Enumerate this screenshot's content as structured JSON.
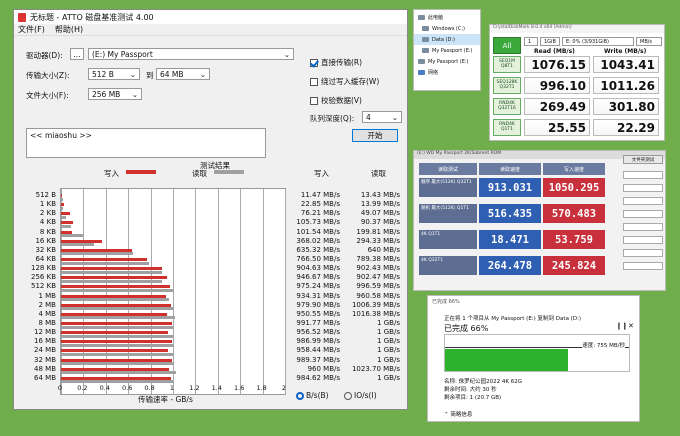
{
  "atto": {
    "title": "无标题 - ATTO 磁盘基准测试 4.00",
    "menu": [
      "文件(F)",
      "帮助(H)"
    ],
    "drive_label": "驱动器(D):",
    "drive_btn": "...",
    "drive_value": "(E:) My Passport",
    "transfer_label": "传输大小(Z):",
    "transfer_from": "512 B",
    "transfer_to_label": "到",
    "transfer_to": "64 MB",
    "file_label": "文件大小(F):",
    "file_value": "256 MB",
    "direct_io": "直接传输(R)",
    "bypass_cache": "绕过写入缓存(W)",
    "verify": "校验数据(V)",
    "queue_label": "队列深度(Q):",
    "queue_value": "4",
    "start": "开始",
    "notes": "<< miaoshu >>",
    "legend_title": "测试结果",
    "legend_write": "写入",
    "legend_read": "读取",
    "col_write": "写入",
    "col_read": "读取",
    "axis_label": "传输速率 - GB/s",
    "unit_bs": "B/s(B)",
    "unit_ios": "IO/s(I)",
    "colors": {
      "write": "#d0312d",
      "read": "#a0a0a0"
    }
  },
  "chart_data": {
    "type": "bar",
    "title": "测试结果",
    "xlabel": "传输速率 - GB/s",
    "xlim": [
      0,
      2
    ],
    "xticks": [
      "0",
      "0.2",
      "0.4",
      "0.6",
      "0.8",
      "1",
      "1.2",
      "1.4",
      "1.6",
      "1.8",
      "2"
    ],
    "categories": [
      "512 B",
      "1 KB",
      "2 KB",
      "4 KB",
      "8 KB",
      "16 KB",
      "32 KB",
      "64 KB",
      "128 KB",
      "256 KB",
      "512 KB",
      "1 MB",
      "2 MB",
      "4 MB",
      "8 MB",
      "12 MB",
      "16 MB",
      "24 MB",
      "32 MB",
      "48 MB",
      "64 MB"
    ],
    "series": [
      {
        "name": "写入",
        "values": [
          0.01147,
          0.02285,
          0.07621,
          0.10573,
          0.10154,
          0.36802,
          0.63532,
          0.7665,
          0.90463,
          0.94667,
          0.97524,
          0.93431,
          0.9799,
          0.95055,
          0.99177,
          0.95652,
          0.98699,
          0.95844,
          0.98937,
          0.96,
          0.98462
        ]
      },
      {
        "name": "读取",
        "values": [
          0.01343,
          0.01399,
          0.04907,
          0.09037,
          0.19981,
          0.29433,
          0.64,
          0.78938,
          0.90243,
          0.90247,
          0.99659,
          0.96058,
          1.00639,
          1.01638,
          1,
          1,
          1,
          1,
          1,
          1.0237,
          1
        ]
      }
    ],
    "write_text": [
      "11.47 MB/s",
      "22.85 MB/s",
      "76.21 MB/s",
      "105.73 MB/s",
      "101.54 MB/s",
      "368.02 MB/s",
      "635.32 MB/s",
      "766.50 MB/s",
      "904.63 MB/s",
      "946.67 MB/s",
      "975.24 MB/s",
      "934.31 MB/s",
      "979.90 MB/s",
      "950.55 MB/s",
      "991.77 MB/s",
      "956.52 MB/s",
      "986.99 MB/s",
      "958.44 MB/s",
      "989.37 MB/s",
      "960 MB/s",
      "984.62 MB/s"
    ],
    "read_text": [
      "13.43 MB/s",
      "13.99 MB/s",
      "49.07 MB/s",
      "90.37 MB/s",
      "199.81 MB/s",
      "294.33 MB/s",
      "640 MB/s",
      "789.38 MB/s",
      "902.43 MB/s",
      "902.47 MB/s",
      "996.59 MB/s",
      "960.58 MB/s",
      "1006.39 MB/s",
      "1016.38 MB/s",
      "1 GB/s",
      "1 GB/s",
      "1 GB/s",
      "1 GB/s",
      "1 GB/s",
      "1023.70 MB/s",
      "1 GB/s"
    ]
  },
  "explorer": {
    "items": [
      "此电脑",
      "Windows (C:)",
      "Data (D:)",
      "My Passport (E:)",
      "My Passport (E:)",
      "网络"
    ]
  },
  "cdm": {
    "title": "CrystalDiskMark 8.0.4 x64 [Admin]",
    "all": "All",
    "runs": "1",
    "size": "1GiB",
    "drive": "E: 0% (3/931GiB)",
    "unit": "MB/s",
    "read_head": "Read (MB/s)",
    "write_head": "Write (MB/s)",
    "rows": [
      {
        "label": "SEQ1M Q8T1",
        "read": "1076.15",
        "write": "1043.41"
      },
      {
        "label": "SEQ128K Q32T1",
        "read": "996.10",
        "write": "1011.26"
      },
      {
        "label": "RND4K Q32T16",
        "read": "269.49",
        "write": "301.80"
      },
      {
        "label": "RND4K Q1T1",
        "read": "25.55",
        "write": "22.29"
      }
    ]
  },
  "asssd": {
    "title": "(E:) WD My Passport 2K/Sabrent ROM",
    "h1": "读取测试",
    "h2": "读取速度",
    "h3": "写入速度",
    "rows": [
      {
        "label": "顺序 最大(512K) Q32T1",
        "a": "913.031",
        "b": "1050.295"
      },
      {
        "label": "随机 最大(512K) Q1T1",
        "a": "516.435",
        "b": "570.483"
      },
      {
        "label": "4K Q1T1",
        "a": "18.471",
        "b": "53.759"
      },
      {
        "label": "4K Q32T1",
        "a": "264.478",
        "b": "245.824"
      }
    ],
    "side_btn": "文件夹测试"
  },
  "copy": {
    "title": "已完成 66%",
    "line": "正在将 1 个项目从 My Passport (E:) 复制到 Data (D:)",
    "percent": "已完成 66%",
    "progress": 0.66,
    "speed": "速度: 755 MB/秒",
    "name": "名称: 侏罗纪公园2022 4K 62G",
    "remaining": "剩余时间: 大约 30 秒",
    "items_left": "剩余项目: 1 (20.7 GB)",
    "less": "简略信息"
  }
}
